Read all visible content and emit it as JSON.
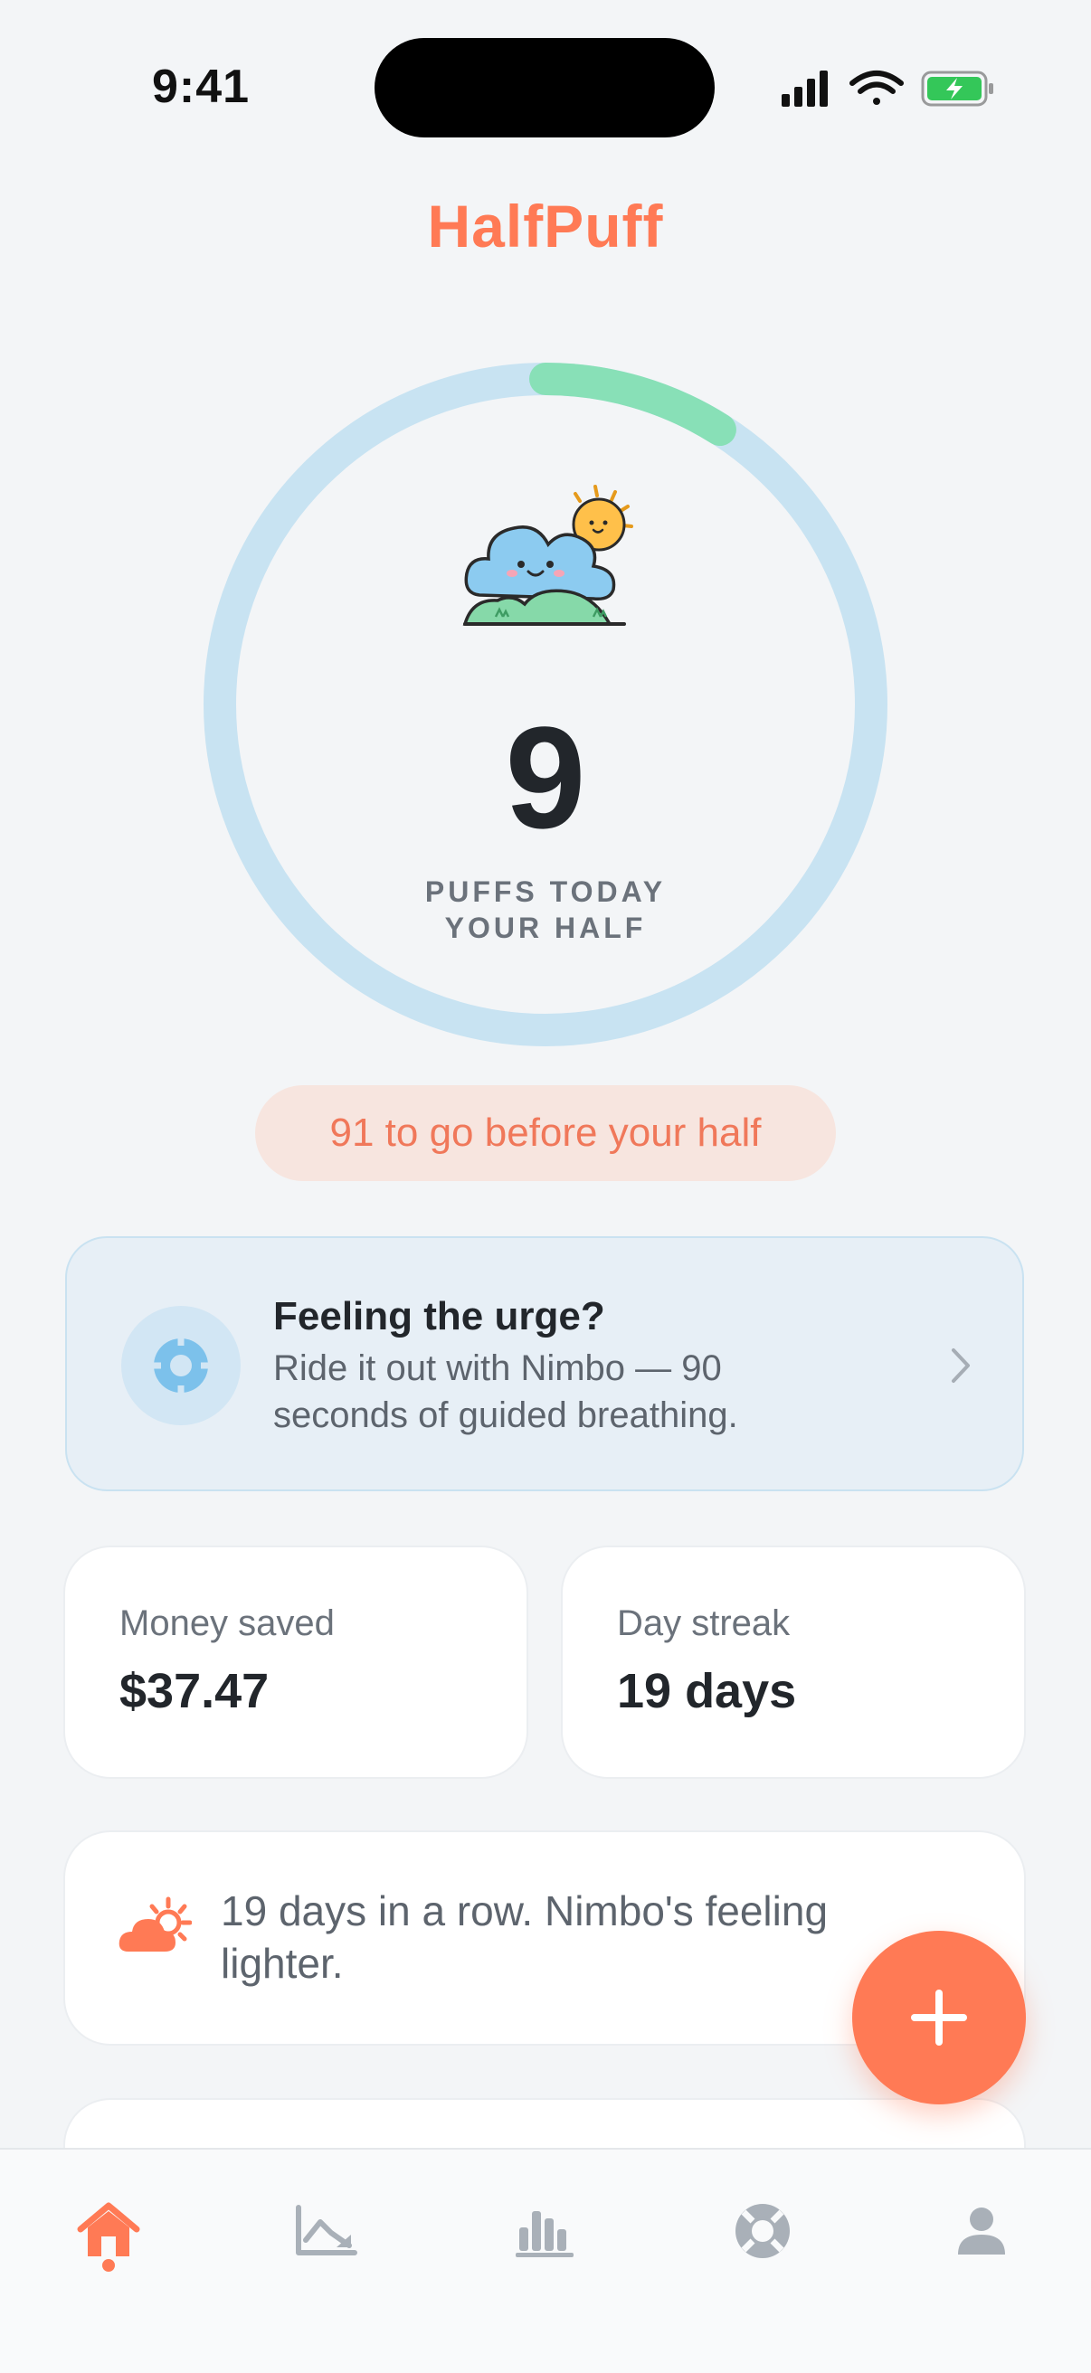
{
  "status_bar": {
    "time": "9:41"
  },
  "header": {
    "title": "HalfPuff"
  },
  "progress": {
    "count": "9",
    "caption_line1": "PUFFS TODAY",
    "caption_line2": "YOUR HALF",
    "fraction": 0.09,
    "remaining_text": "91 to go before your half"
  },
  "urge_card": {
    "title": "Feeling the urge?",
    "body": "Ride it out with Nimbo — 90 seconds of guided breathing."
  },
  "stats": {
    "money": {
      "label": "Money saved",
      "value": "$37.47"
    },
    "streak": {
      "label": "Day streak",
      "value": "19 days"
    }
  },
  "message_card": {
    "text": "19 days in a row. Nimbo's feeling lighter."
  },
  "tab_bar": {
    "active": "home",
    "tabs": [
      "home-icon",
      "trend-icon",
      "stats-icon",
      "support-icon",
      "profile-icon"
    ]
  },
  "colors": {
    "accent": "#FF7A55",
    "ring_track": "#C8E3F2",
    "ring_progress": "#88E0B7",
    "urge_card_bg": "#E7EFF6"
  }
}
